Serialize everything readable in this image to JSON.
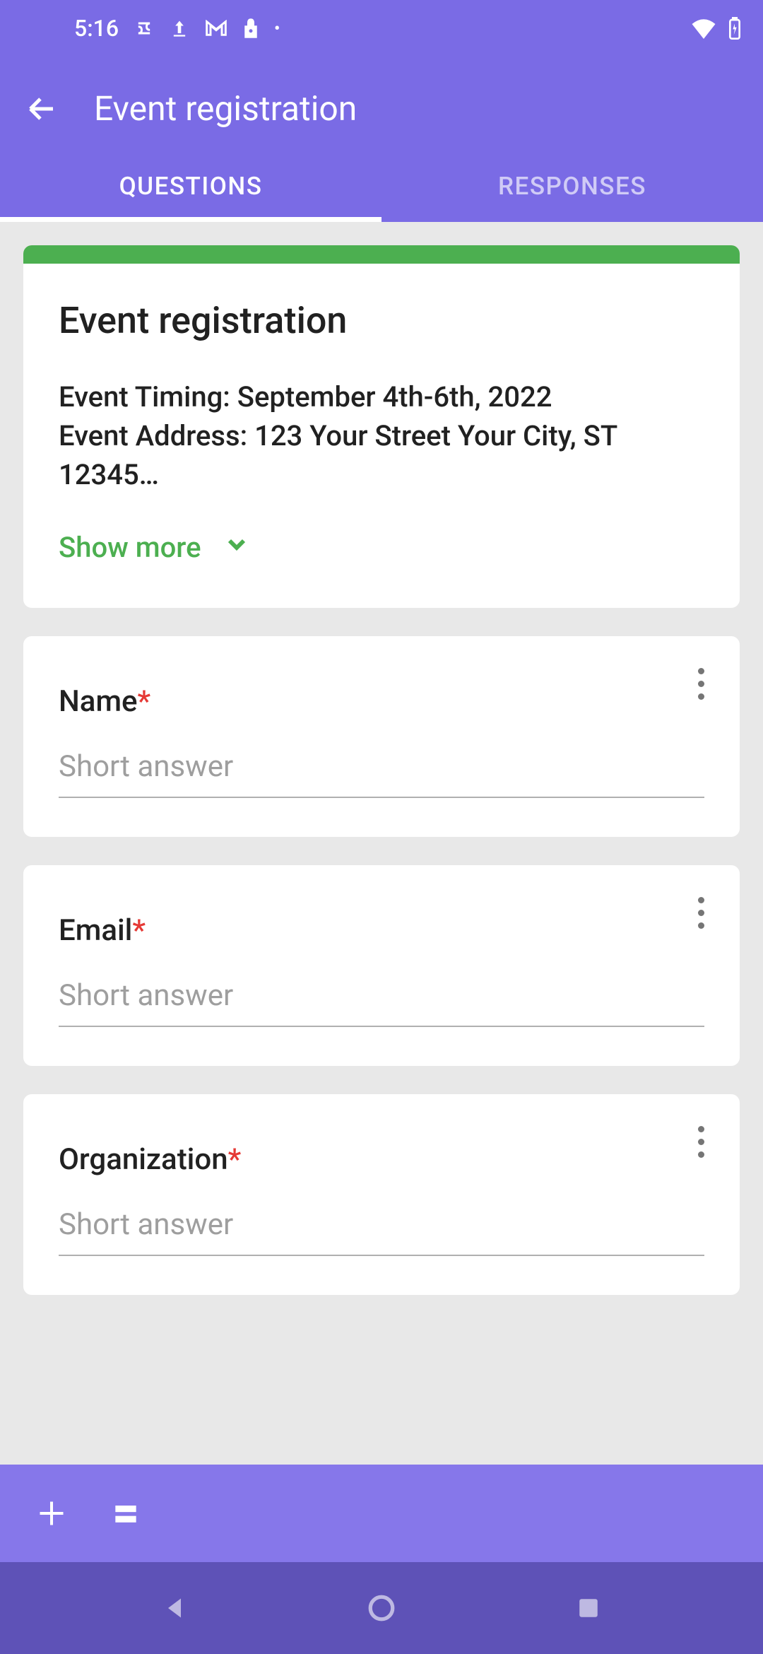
{
  "status": {
    "time": "5:16"
  },
  "header": {
    "title": "Event registration"
  },
  "tabs": {
    "questions": "QUESTIONS",
    "responses": "RESPONSES"
  },
  "form_header": {
    "title": "Event registration",
    "description": "Event Timing: September 4th-6th, 2022\nEvent Address: 123 Your Street Your City, ST 12345…",
    "show_more": "Show more"
  },
  "questions": [
    {
      "label": "Name",
      "required": true,
      "placeholder": "Short answer"
    },
    {
      "label": "Email",
      "required": true,
      "placeholder": "Short answer"
    },
    {
      "label": "Organization",
      "required": true,
      "placeholder": "Short answer"
    }
  ]
}
